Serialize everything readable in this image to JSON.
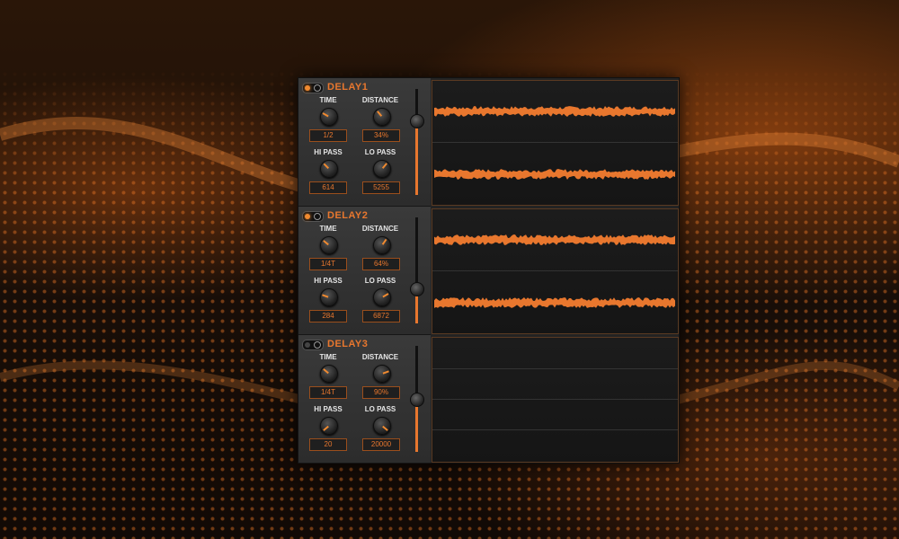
{
  "accent_color": "#e8772e",
  "modules": [
    {
      "title": "DELAY1",
      "enabled": true,
      "fader_level": 0.7,
      "has_waveform": true,
      "controls": {
        "time": {
          "label": "TIME",
          "value": "1/2"
        },
        "distance": {
          "label": "DISTANCE",
          "value": "34%"
        },
        "hi_pass": {
          "label": "HI PASS",
          "value": "614"
        },
        "lo_pass": {
          "label": "LO PASS",
          "value": "5255"
        }
      }
    },
    {
      "title": "DELAY2",
      "enabled": true,
      "fader_level": 0.33,
      "has_waveform": true,
      "controls": {
        "time": {
          "label": "TIME",
          "value": "1/4T"
        },
        "distance": {
          "label": "DISTANCE",
          "value": "64%"
        },
        "hi_pass": {
          "label": "HI PASS",
          "value": "284"
        },
        "lo_pass": {
          "label": "LO PASS",
          "value": "6872"
        }
      }
    },
    {
      "title": "DELAY3",
      "enabled": false,
      "fader_level": 0.5,
      "has_waveform": false,
      "controls": {
        "time": {
          "label": "TIME",
          "value": "1/4T"
        },
        "distance": {
          "label": "DISTANCE",
          "value": "90%"
        },
        "hi_pass": {
          "label": "HI PASS",
          "value": "20"
        },
        "lo_pass": {
          "label": "LO PASS",
          "value": "20000"
        }
      }
    }
  ]
}
